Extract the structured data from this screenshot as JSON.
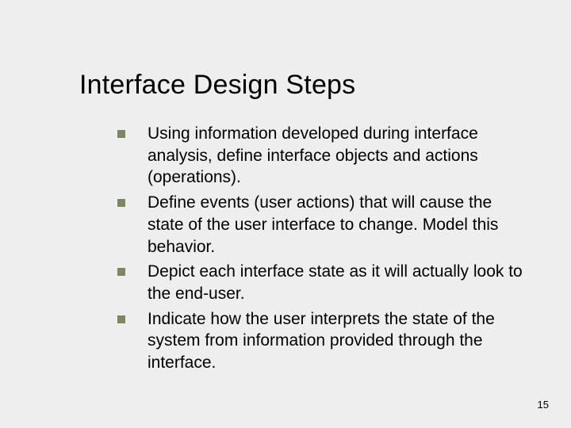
{
  "title": "Interface Design Steps",
  "bullets": [
    "Using information developed during interface analysis, define interface objects and actions (operations).",
    "Define events (user actions) that will cause the state of the user interface to change. Model this behavior.",
    "Depict each interface state as it will actually look to the end-user.",
    "Indicate how the user interprets the state of the system from information provided through the interface."
  ],
  "page_number": "15"
}
